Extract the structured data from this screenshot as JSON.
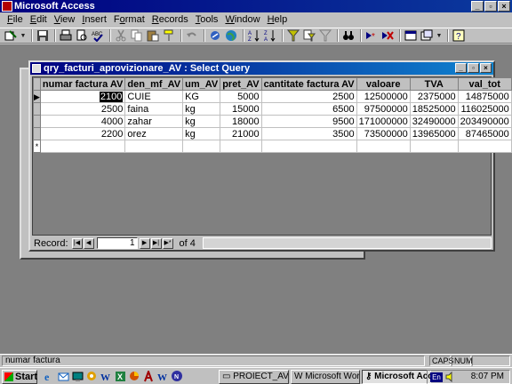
{
  "app": {
    "title": "Microsoft Access"
  },
  "window_buttons": {
    "minimize": "_",
    "restore": "▫",
    "close": "×"
  },
  "menubar": {
    "items": [
      {
        "accel": "F",
        "rest": "ile"
      },
      {
        "accel": "E",
        "rest": "dit"
      },
      {
        "accel": "V",
        "rest": "iew"
      },
      {
        "accel": "I",
        "rest": "nsert"
      },
      {
        "pre": "F",
        "accel": "o",
        "rest": "rmat"
      },
      {
        "accel": "R",
        "rest": "ecords"
      },
      {
        "accel": "T",
        "rest": "ools"
      },
      {
        "accel": "W",
        "rest": "indow"
      },
      {
        "accel": "H",
        "rest": "elp"
      }
    ]
  },
  "toolbar": {
    "icons": [
      "design-view",
      "save",
      "print",
      "print-preview",
      "spelling",
      "cut",
      "copy",
      "paste",
      "format-painter",
      "undo",
      "insert-hyperlink",
      "web-toolbar",
      "sort-ascending",
      "sort-descending",
      "filter-by-selection",
      "filter-by-form",
      "apply-filter",
      "find",
      "new-record",
      "delete-record",
      "database-window",
      "new-object",
      "office-assistant"
    ]
  },
  "query_window": {
    "title": "qry_facturi_aprovizionare_AV : Select Query",
    "columns": [
      "numar factura AV",
      "den_mf_AV",
      "um_AV",
      "pret_AV",
      "cantitate factura AV",
      "valoare",
      "TVA",
      "val_tot"
    ],
    "rows": [
      [
        "2100",
        "CUIE",
        "KG",
        "5000",
        "2500",
        "12500000",
        "2375000",
        "14875000"
      ],
      [
        "2500",
        "faina",
        "kg",
        "15000",
        "6500",
        "97500000",
        "18525000",
        "116025000"
      ],
      [
        "4000",
        "zahar",
        "kg",
        "18000",
        "9500",
        "171000000",
        "32490000",
        "203490000"
      ],
      [
        "2200",
        "orez",
        "kg",
        "21000",
        "3500",
        "73500000",
        "13965000",
        "87465000"
      ]
    ],
    "new_row_marker": "*",
    "current_row_marker": "▶",
    "navigation": {
      "label": "Record:",
      "current": "1",
      "of_text": "of 4",
      "buttons": {
        "first": "|◀",
        "prev": "◀",
        "next": "▶",
        "last": "▶|",
        "new": "▶*"
      }
    }
  },
  "statusbar": {
    "text": "numar factura",
    "caps": "CAPS",
    "num": "NUM"
  },
  "taskbar": {
    "start": "Start",
    "tasks": [
      {
        "label": "PROIECT_AV",
        "active": false
      },
      {
        "label": "Microsoft Word ...",
        "active": false
      },
      {
        "label": "Microsoft Acc...",
        "active": true
      }
    ],
    "language": "En",
    "clock": "8:07 PM"
  }
}
